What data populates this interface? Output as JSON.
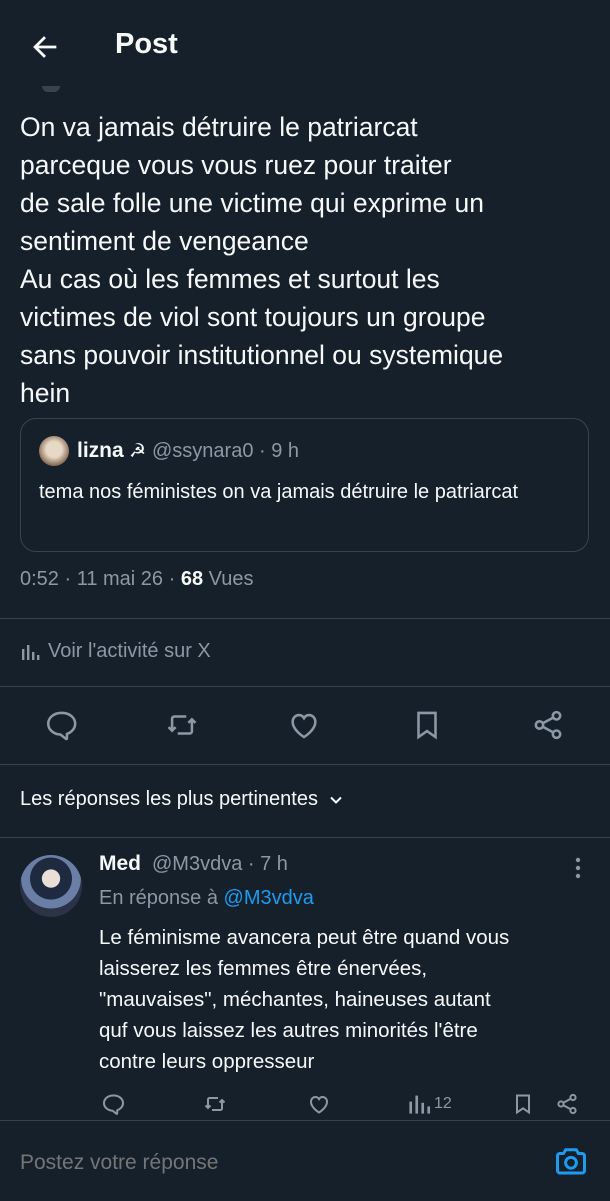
{
  "header": {
    "title": "Post",
    "back_icon": "arrow-left-icon"
  },
  "post": {
    "text": "On va jamais détruire le patriarcat\nparceque vous vous ruez pour traiter\nde sale folle une victime qui exprime un\nsentiment de vengeance\nAu cas où les femmes et surtout les\nvictimes de viol sont toujours un groupe\nsans pouvoir institutionnel ou systemique\nhein",
    "quote": {
      "name": "lizna",
      "name_emoji": "☭",
      "handle_time": "@ssynara0 · 9 h",
      "text": "tema nos féministes on va jamais détruire le patriarcat"
    },
    "meta": {
      "time_date": "0:52 · 11 mai 26 · ",
      "views_count": "68",
      "views_label": " Vues"
    },
    "activity_label": "Voir l'activité sur X",
    "actions": [
      "reply-icon",
      "repost-icon",
      "like-icon",
      "bookmark-icon",
      "share-icon"
    ]
  },
  "replies_sort": {
    "label": "Les réponses les plus pertinentes"
  },
  "reply": {
    "name": "Med",
    "handle_time": "@M3vdva · 7 h",
    "in_reply_prefix": "En réponse à ",
    "in_reply_handle": "@M3vdva",
    "text": "Le féminisme avancera peut être quand vous\nlaisserez les femmes être énervées,\n\"mauvaises\", méchantes, haineuses autant\nquf vous laissez les autres minorités l'être\ncontre leurs oppresseur",
    "views_count": "12"
  },
  "compose": {
    "placeholder": "Postez votre réponse"
  },
  "colors": {
    "background": "#15202b",
    "text": "#f7f9f9",
    "muted": "#8b98a5",
    "accent": "#1d9bf0",
    "border": "#38444d"
  }
}
